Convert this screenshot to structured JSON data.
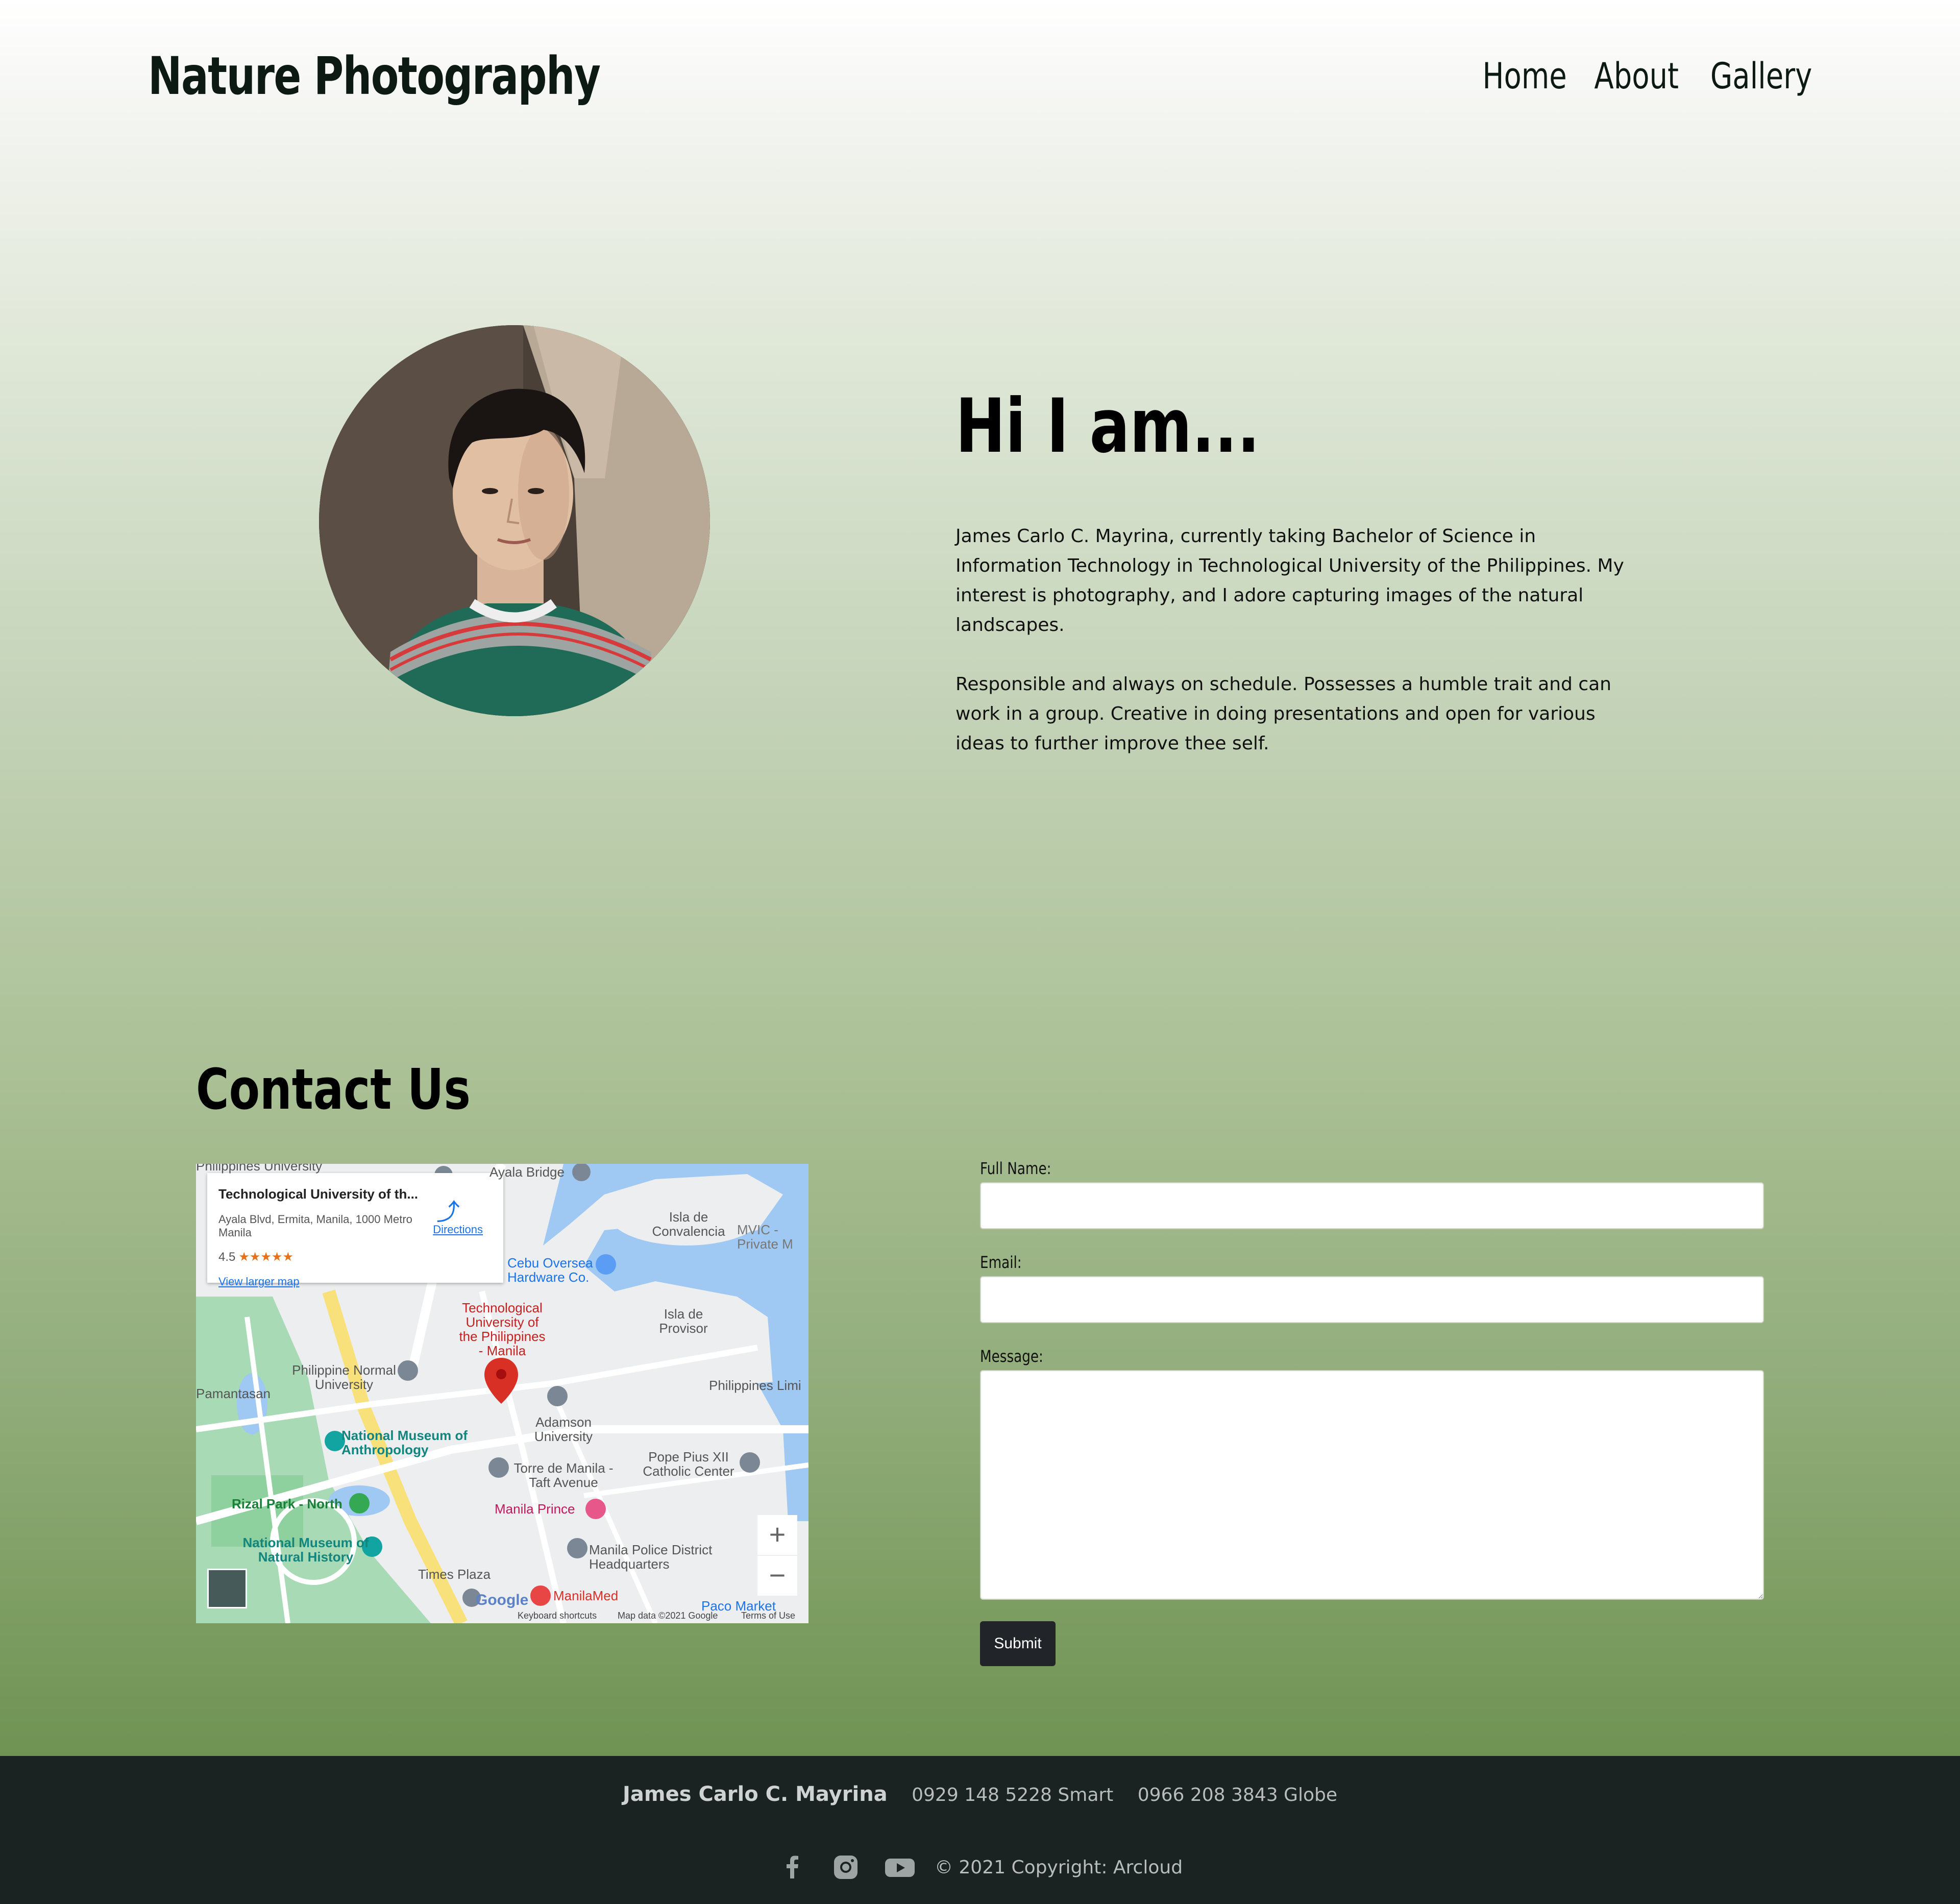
{
  "header": {
    "brand": "Nature Photography",
    "nav": [
      {
        "label": "Home"
      },
      {
        "label": "About"
      },
      {
        "label": "Gallery"
      }
    ]
  },
  "about": {
    "heading": "Hi I am...",
    "paragraphs": [
      "James Carlo C. Mayrina, currently taking Bachelor of Science in Information Technology in Technological University of the Philippines. My interest is photography, and I adore capturing images of the natural landscapes.",
      "Responsible and always on schedule. Possesses a humble trait and can work in a group. Creative in doing presentations and open for various ideas to further improve thee self."
    ]
  },
  "contact": {
    "title": "Contact Us",
    "map": {
      "place_name": "Technological University of th...",
      "address": "Ayala Blvd, Ermita, Manila, 1000 Metro Manila",
      "rating": "4.5",
      "stars": "★★★★★",
      "directions": "Directions",
      "view_larger": "View larger map",
      "labels": {
        "tup": "Technological University of the Philippines - Manila",
        "pnu": "Philippine Normal University",
        "adamson": "Adamson University",
        "anthro": "National Museum of Anthropology",
        "rizal": "Rizal Park - North",
        "natural": "National Museum of Natural History",
        "torre": "Torre de Manila - Taft Avenue",
        "prince": "Manila Prince",
        "police": "Manila Police District Headquarters",
        "pius": "Pope Pius XII Catholic Center",
        "convalecia": "Isla de Convalencia",
        "provisor": "Isla de Provisor",
        "ayala_bridge": "Ayala Bridge",
        "cebu": "Cebu Oversea Hardware Co.",
        "times": "Times Plaza",
        "manilamed": "ManilaMed",
        "paco": "Paco Market",
        "pamantasan": "Pamantasan",
        "phil_univ": "Philippines University",
        "phil_lim": "Philippines Limi",
        "mvic": "MVIC - Private M"
      },
      "footer_keyboard": "Keyboard shortcuts",
      "footer_data": "Map data ©2021 Google",
      "footer_terms": "Terms of Use",
      "google": "Google",
      "zoom_in": "+",
      "zoom_out": "−"
    },
    "form": {
      "name_label": "Full Name:",
      "name_value": "",
      "email_label": "Email:",
      "email_value": "",
      "message_label": "Message:",
      "message_value": "",
      "submit_label": "Submit"
    }
  },
  "footer": {
    "name": "James Carlo C. Mayrina",
    "phone_smart": "0929 148 5228 Smart",
    "phone_globe": "0966 208 3843 Globe",
    "copyright": "© 2021 Copyright: Arcloud",
    "icons": [
      "facebook-icon",
      "instagram-icon",
      "youtube-icon"
    ]
  },
  "colors": {
    "footer_bg": "#1b2222",
    "submit_bg": "#212529",
    "gradient_bottom": "#6f9353"
  }
}
